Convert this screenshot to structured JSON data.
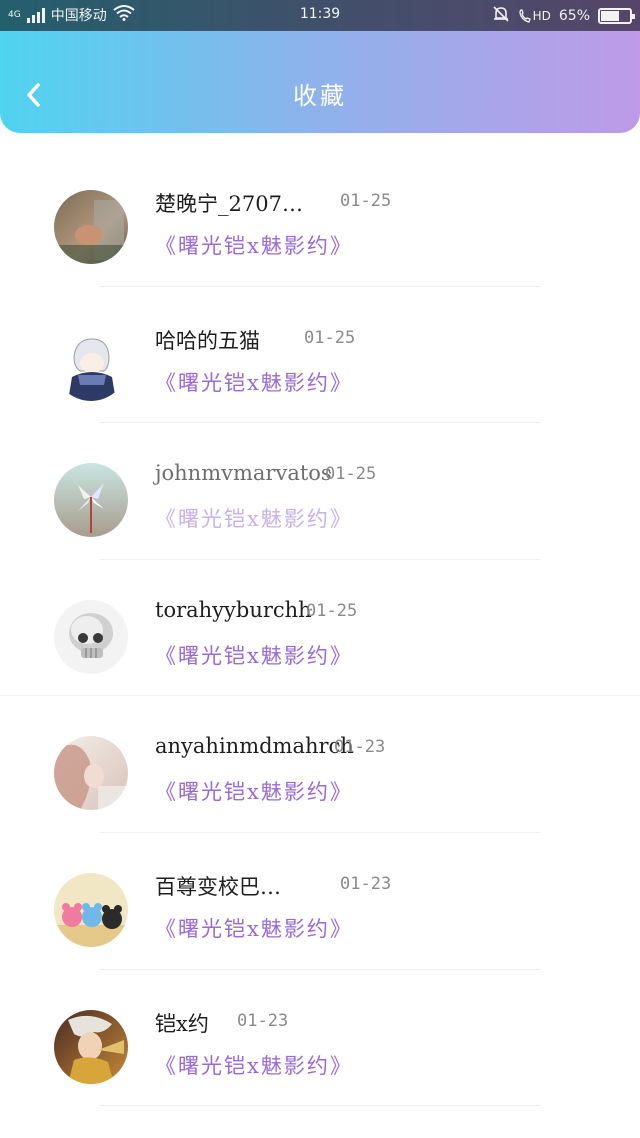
{
  "status_bar": {
    "network": "4G",
    "carrier": "中国移动",
    "time": "11:39",
    "hd": "HD",
    "battery": "65%",
    "battery_level": 0.65,
    "icons": [
      "signal-icon",
      "wifi-icon",
      "bell-muted-icon",
      "hd-call-icon",
      "battery-icon"
    ]
  },
  "header": {
    "title": "收藏",
    "back_icon": "chevron-left-icon",
    "gradient": [
      "#4fd3ef",
      "#be9ae8"
    ]
  },
  "favorites": [
    {
      "name": "楚晚宁_2707…",
      "date": "01-25",
      "book": "《曙光铠x魅影约》"
    },
    {
      "name": "哈哈的五猫",
      "date": "01-25",
      "book": "《曙光铠x魅影约》"
    },
    {
      "name": "johnmvmarvatos",
      "date": "01-25",
      "book": "《曙光铠x魅影约》"
    },
    {
      "name": "torahyyburchh",
      "date": "01-25",
      "book": "《曙光铠x魅影约》"
    },
    {
      "name": "anyahinmdmahrch",
      "date": "01-23",
      "book": "《曙光铠x魅影约》"
    },
    {
      "name": "百尊变校巴…",
      "date": "01-23",
      "book": "《曙光铠x魅影约》"
    },
    {
      "name": "铠x约",
      "date": "01-23",
      "book": "《曙光铠x魅影约》"
    }
  ],
  "colors": {
    "book_title": "#9a6ad8",
    "date": "#8a8a8a",
    "name": "#1e1e1e"
  }
}
